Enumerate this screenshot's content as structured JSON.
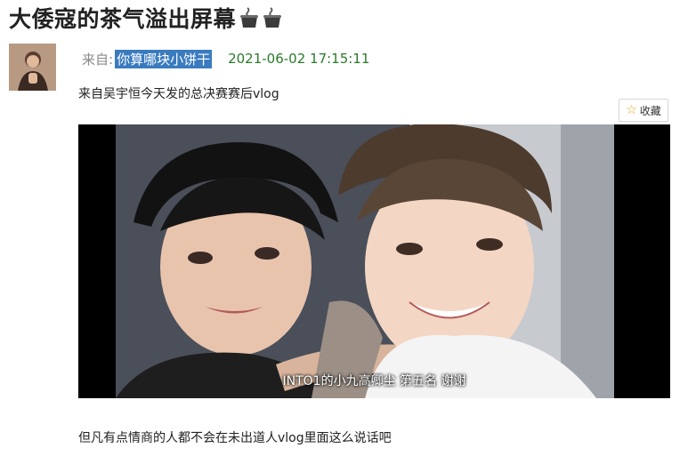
{
  "post": {
    "title": "大倭寇的茶气溢出屏幕",
    "title_emoji": [
      "hot-pot-icon",
      "hot-pot-icon"
    ],
    "from_label": "来自:",
    "author": "你算哪块小饼干",
    "timestamp": "2021-06-02 17:15:11",
    "intro_text": "来自吴宇恒今天发的总决赛赛后vlog",
    "favorite_label": "收藏",
    "video_subtitle": "INTO1的小九高卿尘 第五名 谢谢",
    "body_text": "但凡有点情商的人都不会在未出道人vlog里面这么说话吧"
  },
  "colors": {
    "author_highlight": "#3a7bbf",
    "timestamp": "#2a7a2a",
    "star": "#e8a417"
  }
}
